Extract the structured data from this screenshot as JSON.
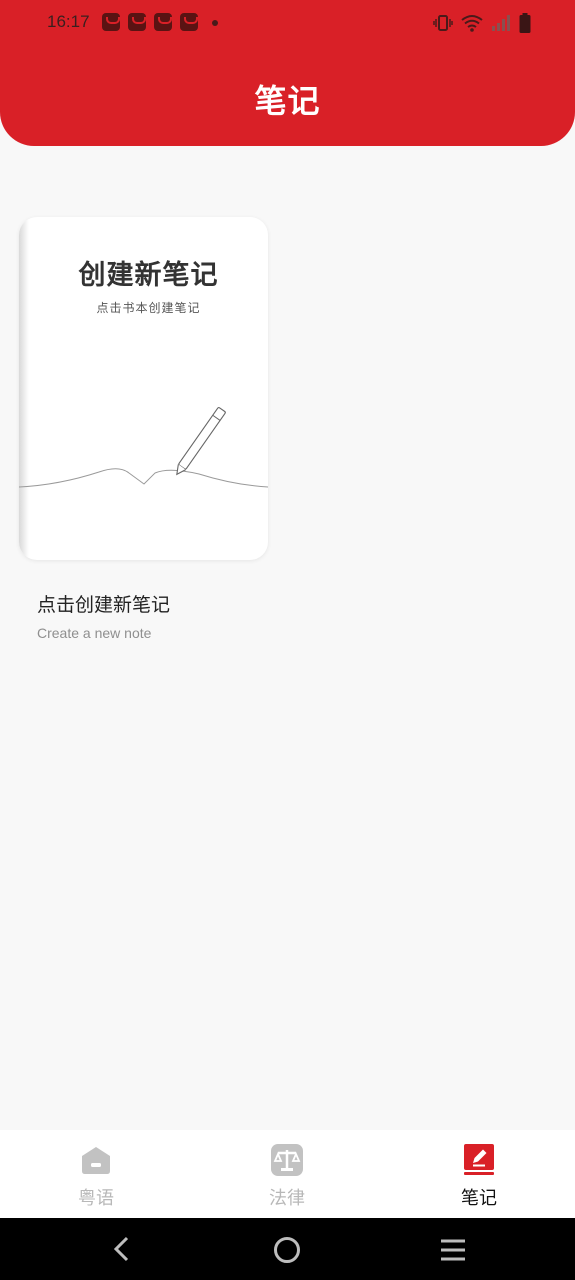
{
  "status_bar": {
    "time": "16:17"
  },
  "header": {
    "title": "笔记",
    "color": "#d92027"
  },
  "notebook_card": {
    "title": "创建新笔记",
    "subtitle": "点击书本创建笔记"
  },
  "new_note": {
    "label": "点击创建新笔记",
    "sublabel": "Create a new note"
  },
  "tabs": [
    {
      "label": "粤语",
      "icon": "home-box-icon",
      "active": false
    },
    {
      "label": "法律",
      "icon": "scales-icon",
      "active": false
    },
    {
      "label": "笔记",
      "icon": "note-edit-icon",
      "active": true
    }
  ],
  "system_nav": {
    "icons": [
      "back-icon",
      "home-circle-icon",
      "recents-menu-icon"
    ]
  }
}
